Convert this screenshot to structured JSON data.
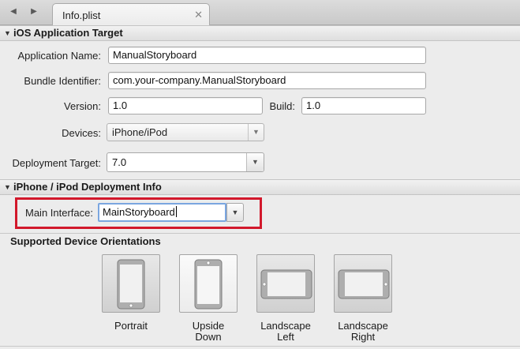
{
  "tab": {
    "title": "Info.plist",
    "close": "✕"
  },
  "nav": {
    "back": "◀",
    "forward": "▶"
  },
  "ios_target": {
    "header": "iOS Application Target",
    "app_name_label": "Application Name:",
    "app_name": "ManualStoryboard",
    "bundle_label": "Bundle Identifier:",
    "bundle_id": "com.your-company.ManualStoryboard",
    "version_label": "Version:",
    "version": "1.0",
    "build_label": "Build:",
    "build": "1.0",
    "devices_label": "Devices:",
    "devices": "iPhone/iPod",
    "deploy_label": "Deployment Target:",
    "deploy_target": "7.0"
  },
  "deployment_info": {
    "header": "iPhone / iPod Deployment Info",
    "main_interface_label": "Main Interface:",
    "main_interface": "MainStoryboard"
  },
  "orientations": {
    "title": "Supported Device Orientations",
    "items": [
      {
        "line1": "Portrait",
        "line2": "",
        "checked": true
      },
      {
        "line1": "Upside",
        "line2": "Down",
        "checked": false
      },
      {
        "line1": "Landscape",
        "line2": "Left",
        "checked": true
      },
      {
        "line1": "Landscape",
        "line2": "Right",
        "checked": true
      }
    ]
  },
  "colors": {
    "highlight": "#d2182b",
    "focus_ring": "#7aa6e0"
  }
}
